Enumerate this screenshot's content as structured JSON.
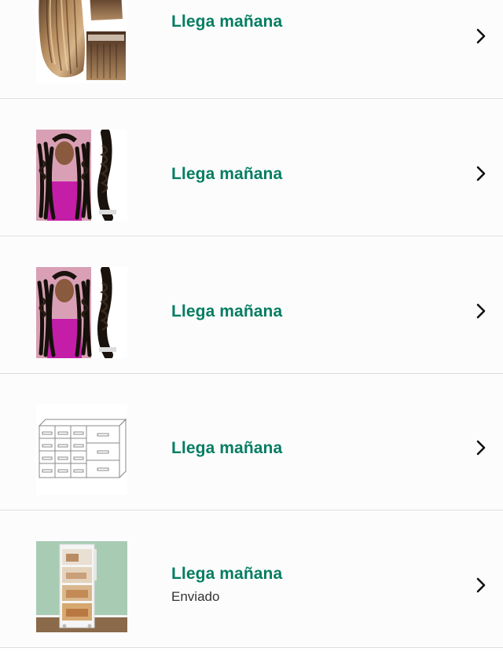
{
  "orders": [
    {
      "status": "Llega mañana",
      "thumbnail": "hair-extensions-clip-in-icon"
    },
    {
      "status": "Llega mañana",
      "thumbnail": "deep-wave-braiding-hair-icon"
    },
    {
      "status": "Llega mañana",
      "thumbnail": "deep-wave-braiding-hair-icon"
    },
    {
      "status": "Llega mañana",
      "thumbnail": "clear-drawer-organizer-icon"
    },
    {
      "status": "Llega mañana",
      "substatus": "Enviado",
      "thumbnail": "storage-cabinet-icon"
    }
  ],
  "colors": {
    "status_green": "#067d62",
    "divider": "#dddddd",
    "row_background": "#fcfcfc"
  }
}
